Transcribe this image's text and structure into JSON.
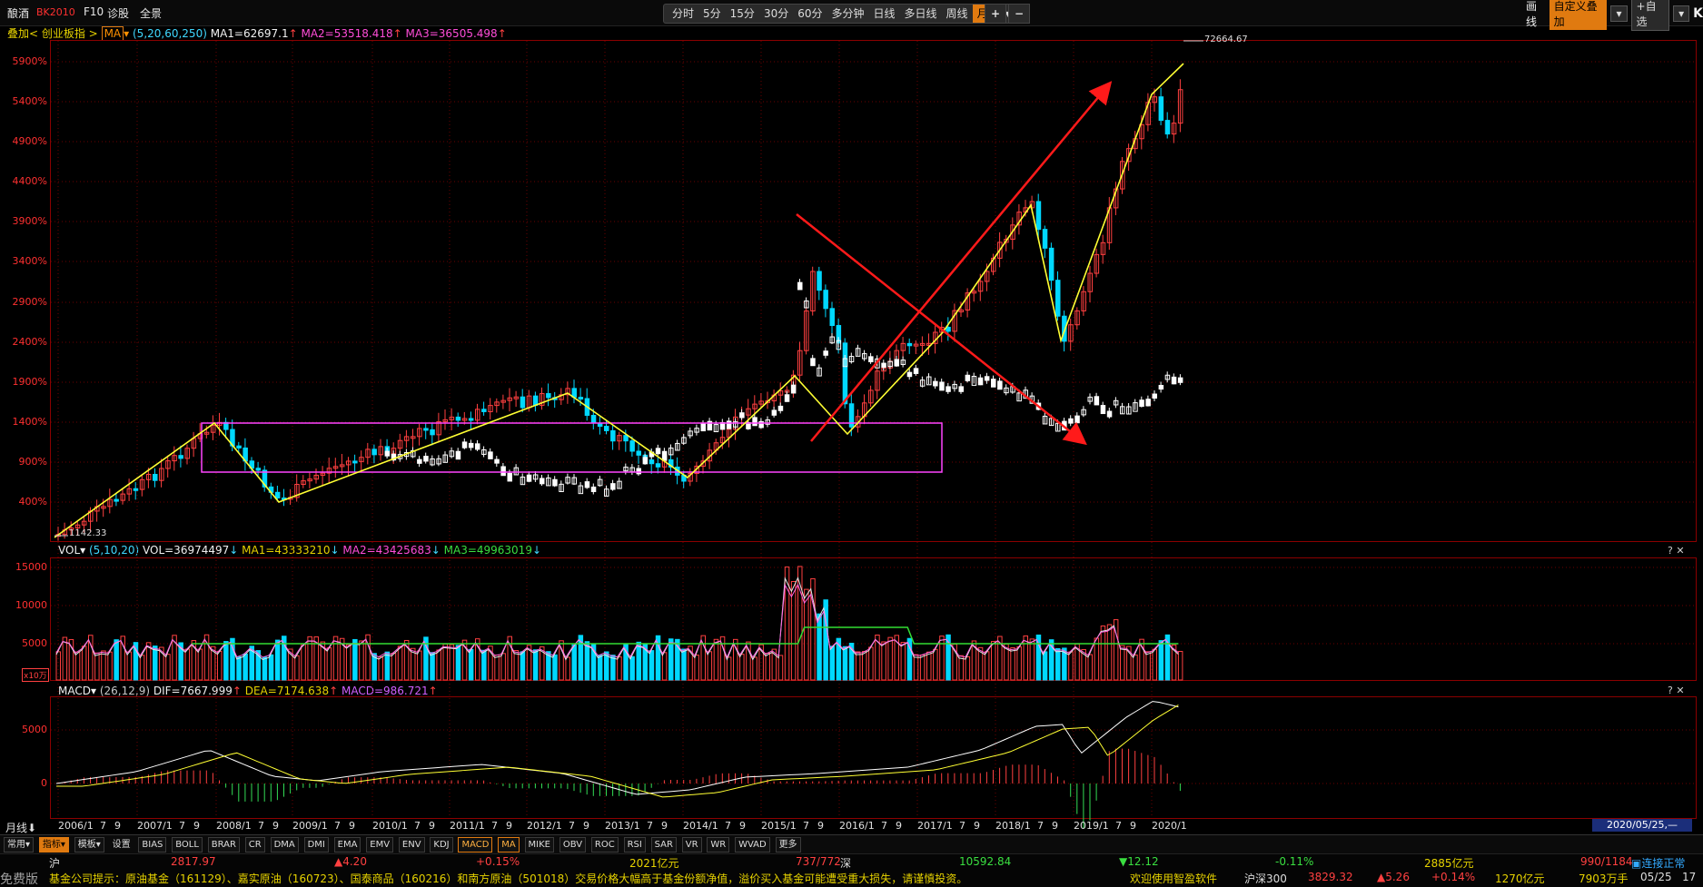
{
  "toolbar": {
    "symbol_name": "酿酒",
    "symbol_code": "BK2010",
    "f10": "F10",
    "diagnose": "诊股",
    "panorama": "全景",
    "periods": [
      "分时",
      "5分",
      "15分",
      "30分",
      "60分",
      "多分钟",
      "日线",
      "多日线",
      "周线",
      "月线"
    ],
    "active_period": "月线",
    "zoom_in": "+",
    "zoom_out": "−",
    "draw_line": "画线",
    "custom_overlay": "自定义叠加",
    "add_watch": "+自选",
    "collapse": "K"
  },
  "main_info": {
    "overlay": "叠加< 创业板指 >",
    "ma_sel": "MA",
    "params": "(5,20,60,250)",
    "ma1": "MA1=62697.1",
    "ma2": "MA2=53518.418",
    "ma3": "MA3=36505.498"
  },
  "vol_info": {
    "name": "VOL",
    "params": "(5,10,20)",
    "vol": "VOL=36974497",
    "ma1": "MA1=43333210",
    "ma2": "MA2=43425683",
    "ma3": "MA3=49963019",
    "unit": "x10万"
  },
  "macd_info": {
    "name": "MACD",
    "params": "(26,12,9)",
    "dif": "DIF=7667.999",
    "dea": "DEA=7174.638",
    "macd": "MACD=986.721"
  },
  "y_ticks_main": [
    "5900%",
    "5400%",
    "4900%",
    "4400%",
    "3900%",
    "3400%",
    "2900%",
    "2400%",
    "1900%",
    "1400%",
    "900%",
    "400%"
  ],
  "y_ticks_vol": [
    "15000",
    "10000",
    "5000"
  ],
  "y_ticks_macd": [
    "5000",
    "0"
  ],
  "high_label": "72664.67",
  "low_label": "1142.33",
  "x_ticks": [
    "2006/1",
    "7",
    "9",
    "2007/1",
    "7",
    "9",
    "2008/1",
    "7",
    "9",
    "2009/1",
    "7",
    "9",
    "2010/1",
    "7",
    "9",
    "2011/1",
    "7",
    "9",
    "2012/1",
    "7",
    "9",
    "2013/1",
    "7",
    "9",
    "2014/1",
    "7",
    "9",
    "2015/1",
    "7",
    "9",
    "2016/1",
    "7",
    "9",
    "2017/1",
    "7",
    "9",
    "2018/1",
    "7",
    "9",
    "2019/1",
    "7",
    "9",
    "2020/1"
  ],
  "period_label": "月线",
  "date_label": "2020/05/25,—",
  "indicator_tabs": [
    "常用",
    "指标",
    "模板",
    "设置",
    "BIAS",
    "BOLL",
    "BRAR",
    "CR",
    "DMA",
    "DMI",
    "EMA",
    "EMV",
    "ENV",
    "KDJ",
    "MACD",
    "MA",
    "MIKE",
    "OBV",
    "ROC",
    "RSI",
    "SAR",
    "VR",
    "WR",
    "WVAD",
    "更多"
  ],
  "active_tab": "MACD",
  "ticker": {
    "sh_label": "沪",
    "sh_index": "2817.97",
    "sh_change": "▲4.20",
    "sh_pct": "+0.15%",
    "sh_amount": "2021亿元",
    "sh_ratio": "737/772",
    "sz_label": "深",
    "sz_index": "10592.84",
    "sz_change": "▼12.12",
    "sz_pct": "-0.11%",
    "sz_amount": "2885亿元",
    "sz_ratio": "990/1184",
    "status": "连接正常"
  },
  "news": {
    "left_tag": "免费版",
    "text": "基金公司提示：原油基金（161129）、嘉实原油（160723）、国泰商品（160216）和南方原油（501018）交易价格大幅高于基金份额净值，溢价买入基金可能遭受重大损失，请谨慎投资。",
    "welcome": "欢迎使用智盈软件",
    "hs300_label": "沪深300",
    "hs300": "3829.32",
    "hs300_chg": "▲5.26",
    "hs300_pct": "+0.14%",
    "hs300_amt": "1270亿元",
    "vol": "7903万手",
    "date": "05/25",
    "time": "17"
  },
  "colors": {
    "up": "#ff4040",
    "down": "#00d8ff",
    "overlay": "#ffffff",
    "trendline": "#ffff33",
    "box": "#ff44ff",
    "arrow": "#ff1a1a",
    "grid": "#8b0000",
    "accent": "#e07a10"
  }
}
